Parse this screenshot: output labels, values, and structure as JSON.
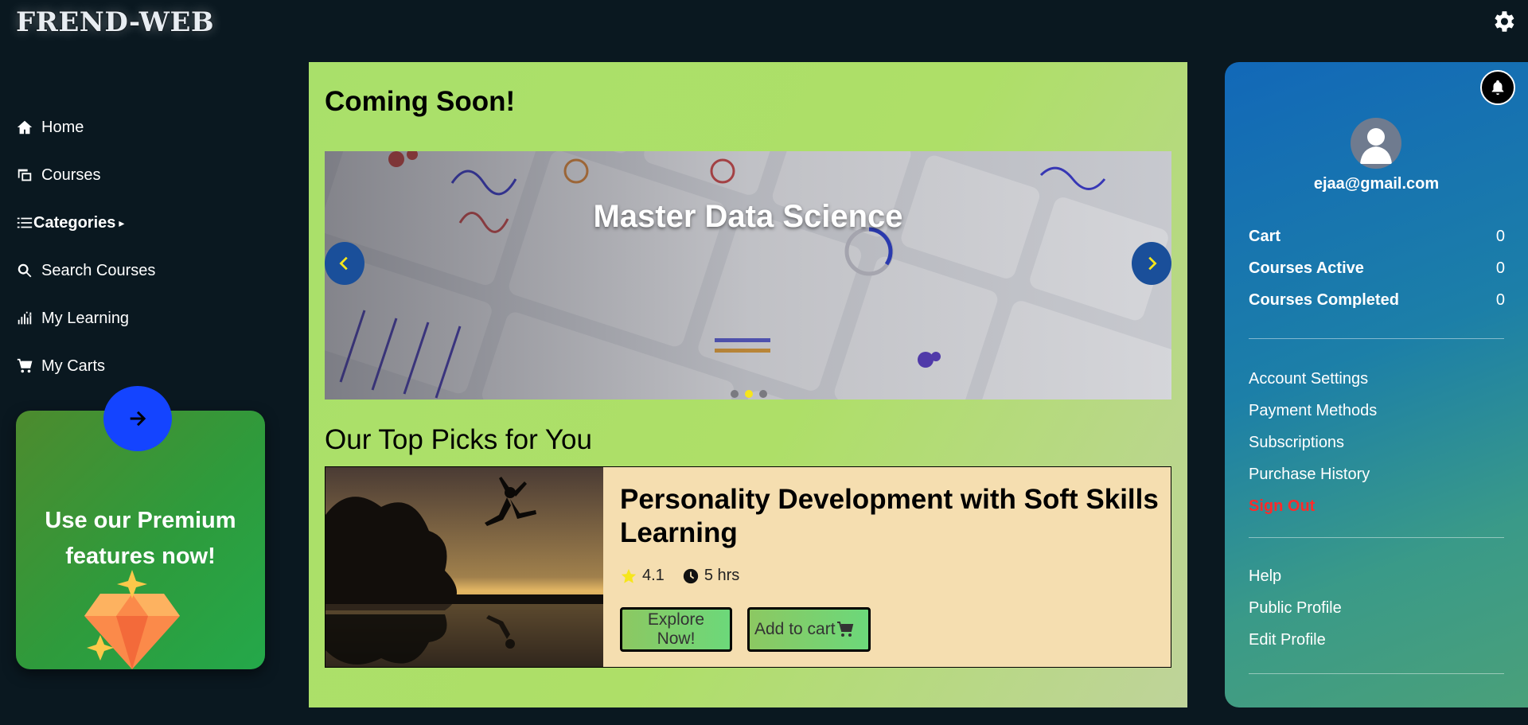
{
  "app": {
    "logo": "FREND-WEB"
  },
  "nav": {
    "items": [
      {
        "label": "Home",
        "icon": "home-icon"
      },
      {
        "label": "Courses",
        "icon": "courses-icon"
      },
      {
        "label": "Categories",
        "icon": "list-icon",
        "caret": "▸"
      },
      {
        "label": "Search Courses",
        "icon": "search-icon"
      },
      {
        "label": "My Learning",
        "icon": "learning-icon"
      },
      {
        "label": "My Carts",
        "icon": "cart-icon"
      }
    ]
  },
  "premium": {
    "text_line1": "Use our Premium",
    "text_line2": "features now!"
  },
  "main": {
    "coming_soon": "Coming Soon!",
    "carousel": {
      "slide_title": "Master Data Science",
      "slide_count": 3,
      "active_slide": 2
    },
    "top_picks_heading": "Our Top Picks for You",
    "course": {
      "title": "Personality Development with Soft Skills Learning",
      "rating": "4.1",
      "duration": "5 hrs",
      "explore_label": "Explore Now!",
      "cart_label": "Add to cart"
    }
  },
  "profile": {
    "email": "ejaa@gmail.com",
    "stats": [
      {
        "label": "Cart",
        "value": "0"
      },
      {
        "label": "Courses Active",
        "value": "0"
      },
      {
        "label": "Courses Completed",
        "value": "0"
      }
    ],
    "links_group1": [
      "Account Settings",
      "Payment Methods",
      "Subscriptions",
      "Purchase History",
      "Sign Out"
    ],
    "links_group2": [
      "Help",
      "Public Profile",
      "Edit Profile"
    ]
  },
  "colors": {
    "background": "#0a1820",
    "main_panel": "#a9e06a",
    "card": "#f5deb0",
    "signout": "#ff2a2a",
    "premium_button": "#1444ff",
    "carousel_dot_active": "#f6e61b"
  }
}
